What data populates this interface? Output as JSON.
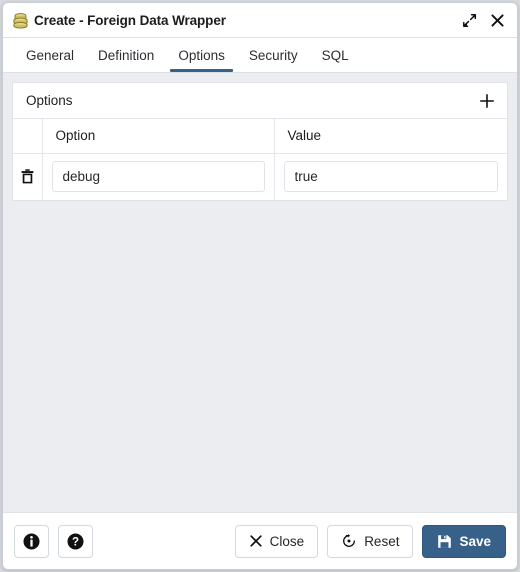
{
  "window": {
    "title": "Create - Foreign Data Wrapper",
    "icon": "database-stack-icon",
    "maximize_icon": "expand-diagonal-icon",
    "close_icon": "close-icon",
    "accent_color": "#376189",
    "background_color": "#ebedf0",
    "panel_background": "#ffffff"
  },
  "tabs": [
    {
      "label": "General",
      "active": false
    },
    {
      "label": "Definition",
      "active": false
    },
    {
      "label": "Options",
      "active": true
    },
    {
      "label": "Security",
      "active": false
    },
    {
      "label": "SQL",
      "active": false
    }
  ],
  "options_panel": {
    "title": "Options",
    "add_icon": "plus-icon",
    "columns": [
      "Option",
      "Value"
    ],
    "rows": [
      {
        "delete_icon": "trash-icon",
        "option": "debug",
        "option_placeholder": "",
        "value": "true",
        "value_placeholder": ""
      }
    ]
  },
  "footer": {
    "info_label": "",
    "info_icon": "info-circle-icon",
    "help_label": "",
    "help_icon": "question-circle-icon",
    "close_label": "Close",
    "close_icon": "x-icon",
    "reset_label": "Reset",
    "reset_icon": "reset-circular-arrow-icon",
    "save_label": "Save",
    "save_icon": "floppy-disk-icon"
  }
}
